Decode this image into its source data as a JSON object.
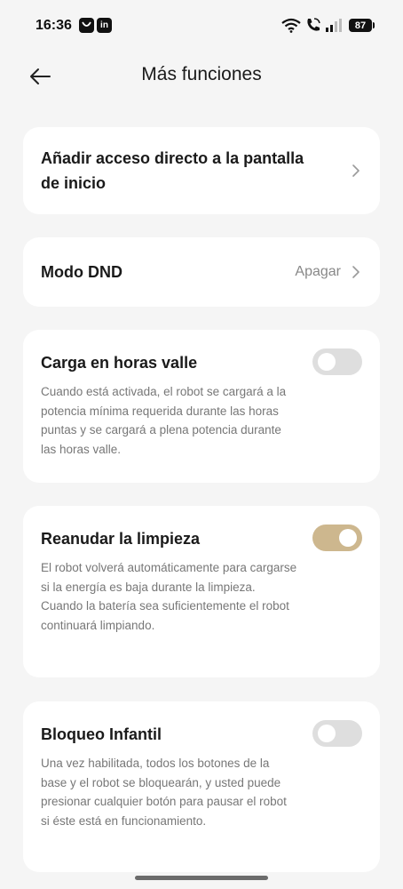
{
  "status_bar": {
    "time": "16:36",
    "app_icons": [
      "notification-app-icon",
      "linkedin-icon"
    ],
    "battery": "87"
  },
  "header": {
    "title": "Más funciones"
  },
  "shortcut_card": {
    "title": "Añadir acceso directo a la pantalla de inicio"
  },
  "dnd_card": {
    "title": "Modo DND",
    "value": "Apagar"
  },
  "offpeak_card": {
    "title": "Carga en horas valle",
    "description": "Cuando está activada, el robot se cargará a la potencia mínima requerida durante las horas puntas y se cargará a plena potencia durante las horas valle.",
    "enabled": false
  },
  "resume_card": {
    "title": "Reanudar la limpieza",
    "description": "El robot volverá automáticamente para cargarse si la energía es baja durante la limpieza. Cuando la batería sea suficientemente el robot continuará limpiando.",
    "enabled": true
  },
  "childlock_card": {
    "title": "Bloqueo Infantil",
    "description": "Una vez habilitada, todos los botones de la base y el robot se bloquearán, y usted puede presionar cualquier botón para pausar el robot si éste está en funcionamiento.",
    "enabled": false
  },
  "colors": {
    "background": "#f5f5f5",
    "toggle_on": "#cdb78e",
    "toggle_off": "#dedede"
  }
}
